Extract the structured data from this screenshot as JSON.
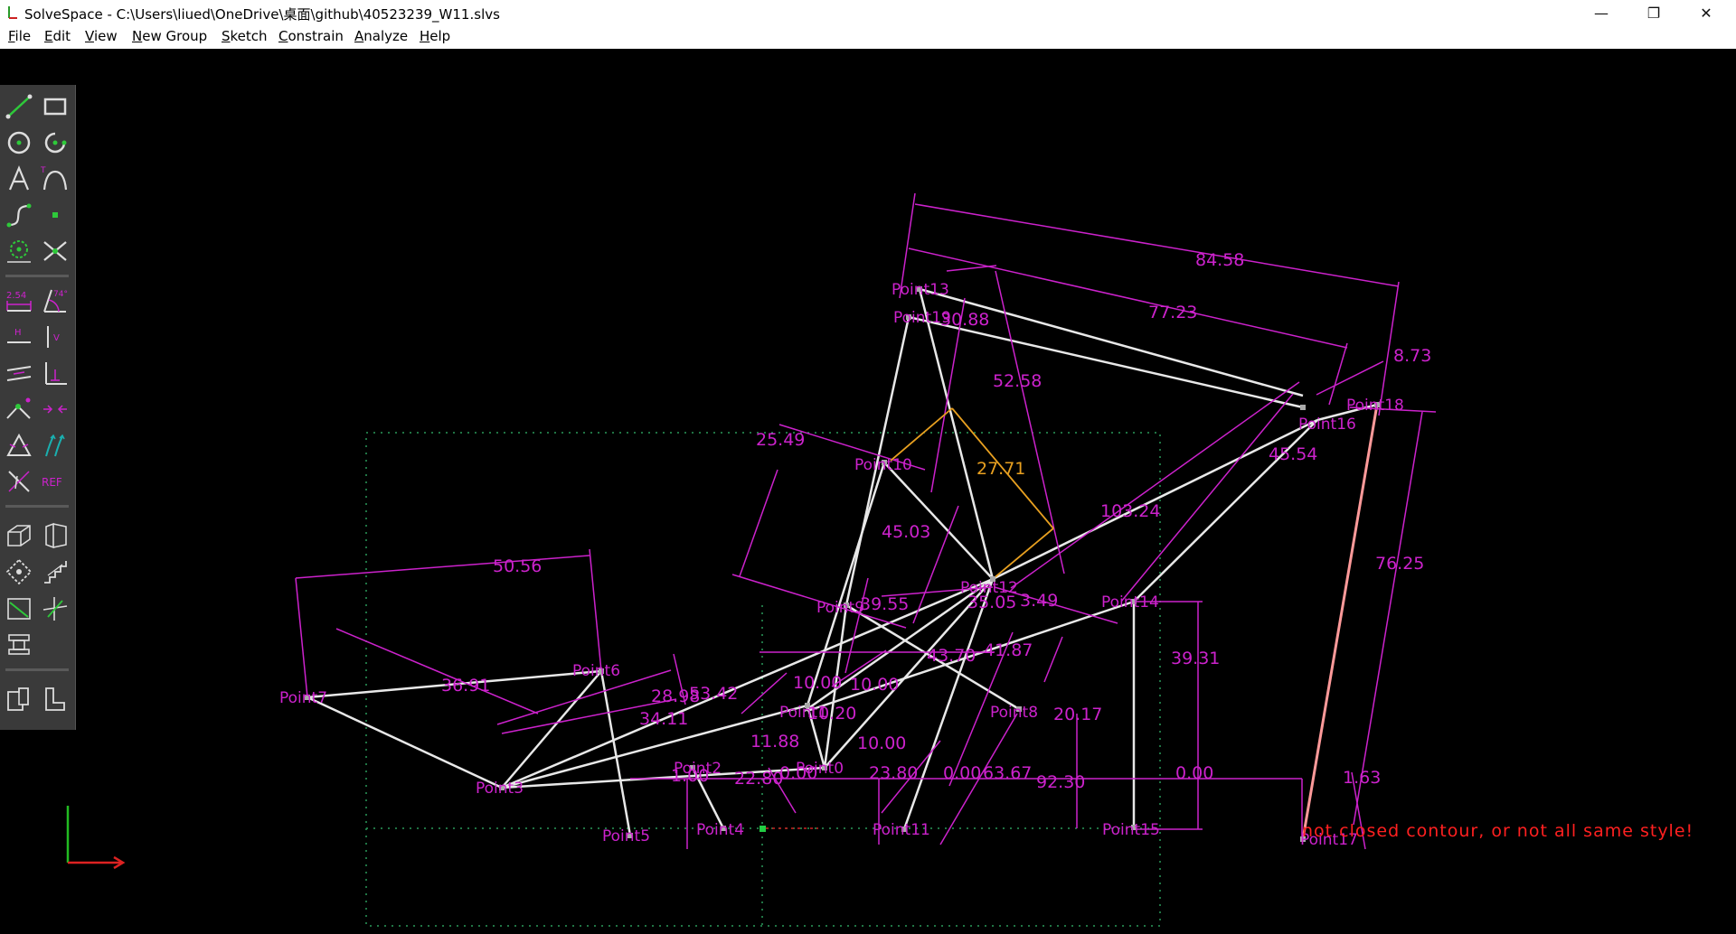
{
  "window": {
    "title": "SolveSpace - C:\\Users\\liued\\OneDrive\\桌面\\github\\40523239_W11.slvs",
    "minimize_glyph": "—",
    "restore_glyph": "❐",
    "close_glyph": "✕"
  },
  "menu": [
    {
      "label": "File",
      "key": "F",
      "rest": "ile"
    },
    {
      "label": "Edit",
      "key": "E",
      "rest": "dit"
    },
    {
      "label": "View",
      "key": "V",
      "rest": "iew"
    },
    {
      "label": "New Group",
      "key": "N",
      "rest": "ew Group"
    },
    {
      "label": "Sketch",
      "key": "S",
      "rest": "ketch"
    },
    {
      "label": "Constrain",
      "key": "C",
      "rest": "onstrain"
    },
    {
      "label": "Analyze",
      "key": "A",
      "rest": "nalyze"
    },
    {
      "label": "Help",
      "key": "H",
      "rest": "elp"
    }
  ],
  "toolbar": {
    "icons": [
      "line-icon",
      "rectangle-icon",
      "circle-icon",
      "arc-icon",
      "text-icon",
      "tangent-arc-icon",
      "bezier-icon",
      "point-icon",
      "construction-circle-icon",
      "split-curves-icon",
      "distance-constraint-icon",
      "angle-constraint-icon",
      "horizontal-constraint-icon",
      "vertical-constraint-icon",
      "parallel-constraint-icon",
      "perpendicular-constraint-icon",
      "point-on-line-icon",
      "symmetric-icon",
      "equal-icon",
      "same-orientation-icon",
      "other-supplementary-icon",
      "reference-icon",
      "nearest-iso-view-icon",
      "nearest-ortho-view-icon",
      "workplane-icon",
      "step-translate-icon",
      "sketch-in-3d-icon",
      "sketch-in-workplane-icon",
      "extrude-icon",
      "lathe-icon",
      "assembly-icon",
      "import-icon"
    ],
    "dist_label": "2.54",
    "angle_label": "74°",
    "h_label": "H",
    "v_label": "V",
    "ref_label": "REF"
  },
  "sketch": {
    "points": [
      "Point13",
      "Point19",
      "Point16",
      "Point18",
      "Point10",
      "Point12",
      "Point9",
      "Point14",
      "Point6",
      "Point7",
      "Point3",
      "Point5",
      "Point4",
      "Point2",
      "Point1",
      "Point0",
      "Point8",
      "Point11",
      "Point15",
      "Point17"
    ],
    "dimensions": [
      "84.58",
      "77.23",
      "30.88",
      "52.58",
      "8.73",
      "27.71",
      "25.49",
      "103.24",
      "45.54",
      "45.03",
      "76.25",
      "50.56",
      "39.55",
      "35.05",
      "3.49",
      "39.31",
      "36.91",
      "28.98",
      "53.42",
      "34.11",
      "43.70",
      "41.87",
      "10.00",
      "10.00",
      "10.20",
      "20.17",
      "11.88",
      "10.00",
      "23.80",
      "0.00",
      "63.67",
      "92.30",
      "0.00",
      "1.00",
      "22.80",
      "0.00",
      "1.63"
    ],
    "error_message": "not closed contour, or not all same style!",
    "colors": {
      "constraint": "#cc22cc",
      "geometry": "#e8e8e8",
      "selected_angle": "#e8a020",
      "error": "#ff2020",
      "construction": "#2a9a5a"
    }
  }
}
